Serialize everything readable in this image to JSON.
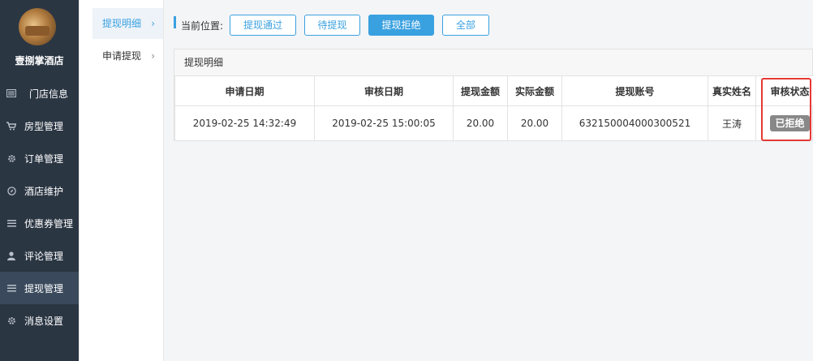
{
  "sidebar": {
    "hotel_name": "壹捌掌酒店",
    "items": [
      {
        "label": "门店信息",
        "icon": "store-icon"
      },
      {
        "label": "房型管理",
        "icon": "cart-icon"
      },
      {
        "label": "订单管理",
        "icon": "gear-icon"
      },
      {
        "label": "酒店维护",
        "icon": "compass-icon"
      },
      {
        "label": "优惠券管理",
        "icon": "list-icon"
      },
      {
        "label": "评论管理",
        "icon": "user-icon"
      },
      {
        "label": "提现管理",
        "icon": "list-icon",
        "active": true
      },
      {
        "label": "消息设置",
        "icon": "gear-icon"
      }
    ]
  },
  "subnav": {
    "items": [
      {
        "label": "提现明细",
        "active": true
      },
      {
        "label": "申请提现",
        "active": false
      }
    ]
  },
  "breadcrumb": {
    "label": "当前位置:"
  },
  "filters": [
    {
      "label": "提现通过",
      "active": false
    },
    {
      "label": "待提现",
      "active": false
    },
    {
      "label": "提现拒绝",
      "active": true
    },
    {
      "label": "全部",
      "active": false
    }
  ],
  "panel": {
    "title": "提现明细",
    "columns": [
      "申请日期",
      "审核日期",
      "提现金额",
      "实际金额",
      "提现账号",
      "真实姓名",
      "审核状态"
    ],
    "rows": [
      {
        "apply_date": "2019-02-25 14:32:49",
        "review_date": "2019-02-25 15:00:05",
        "amount": "20.00",
        "actual_amount": "20.00",
        "account": "632150004000300521",
        "real_name": "王涛",
        "status": "已拒绝"
      }
    ]
  },
  "colors": {
    "sidebar_bg": "#2b3643",
    "accent": "#3aa1e0",
    "highlight": "#e53935",
    "badge": "#888888"
  }
}
